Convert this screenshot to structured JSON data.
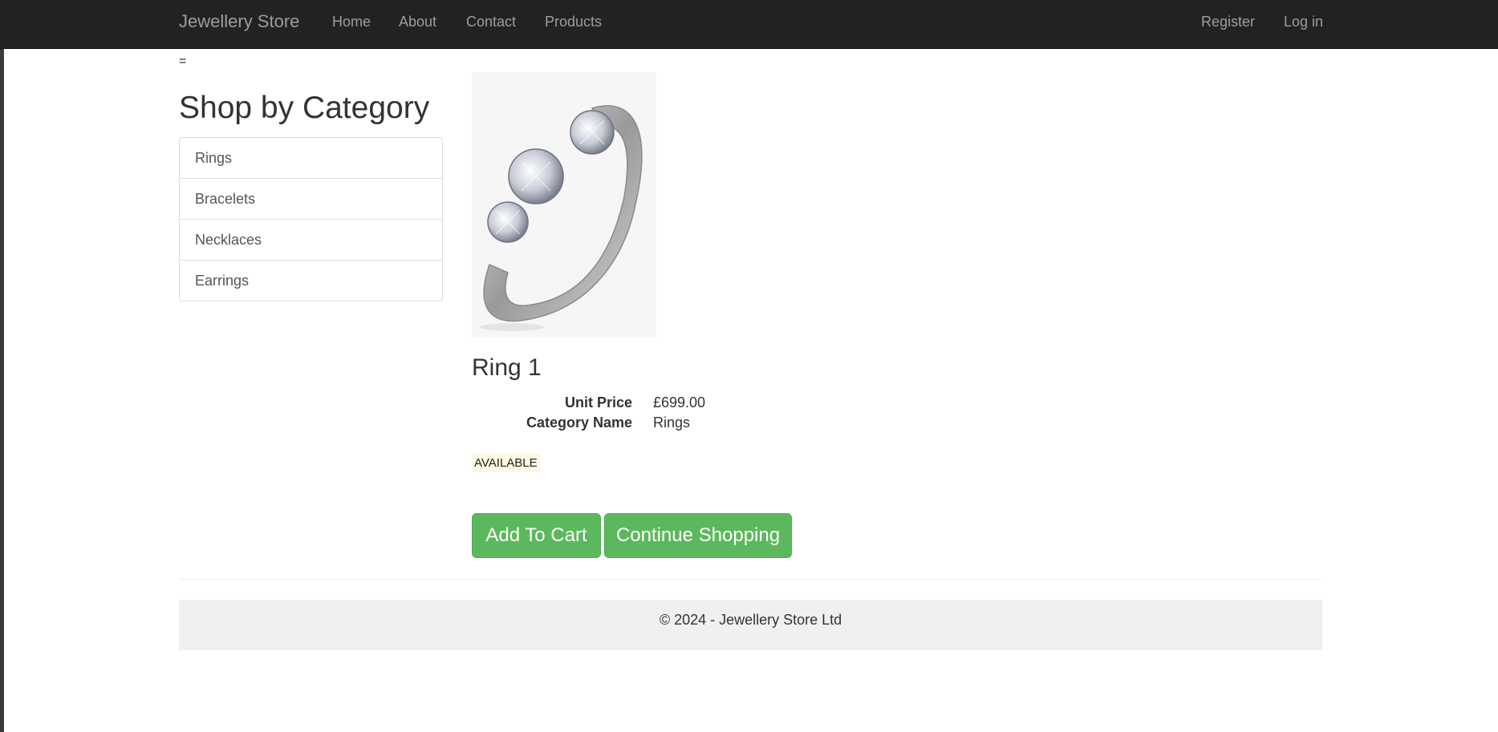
{
  "nav": {
    "brand": "Jewellery Store",
    "links": [
      "Home",
      "About",
      "Contact",
      "Products"
    ],
    "right_links": [
      "Register",
      "Log in"
    ]
  },
  "misc": {
    "eq": "="
  },
  "sidebar": {
    "title": "Shop by Category",
    "categories": [
      "Rings",
      "Bracelets",
      "Necklaces",
      "Earrings"
    ]
  },
  "product": {
    "image_icon": "ring-image",
    "name": "Ring 1",
    "details": [
      {
        "label": "Unit Price",
        "value": "£699.00"
      },
      {
        "label": "Category Name",
        "value": "Rings"
      }
    ],
    "status": "AVAILABLE",
    "buttons": {
      "add_to_cart": "Add To Cart",
      "continue": "Continue Shopping"
    }
  },
  "footer": {
    "text": "© 2024 - Jewellery Store Ltd"
  },
  "colors": {
    "navbar": "#222222",
    "button": "#5cb85c",
    "badge_bg": "#fcf8e3",
    "footer_bg": "#f0f0f0"
  }
}
